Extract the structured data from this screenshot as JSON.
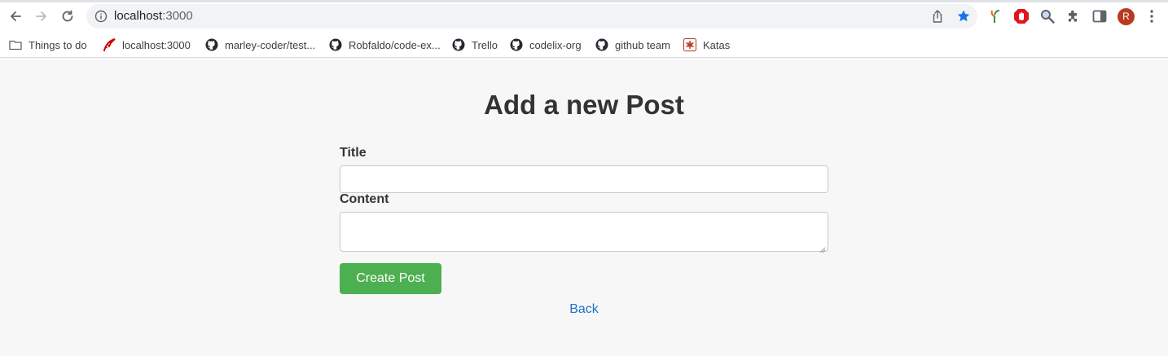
{
  "browser": {
    "url_host": "localhost",
    "url_port": ":3000",
    "avatar_letter": "R"
  },
  "bookmarks": [
    {
      "label": "Things to do",
      "icon": "folder-icon"
    },
    {
      "label": "localhost:3000",
      "icon": "rails-icon"
    },
    {
      "label": "marley-coder/test...",
      "icon": "github-icon"
    },
    {
      "label": "Robfaldo/code-ex...",
      "icon": "github-icon"
    },
    {
      "label": "Trello",
      "icon": "github-icon"
    },
    {
      "label": "codelix-org",
      "icon": "github-icon"
    },
    {
      "label": "github team",
      "icon": "github-icon"
    },
    {
      "label": "Katas",
      "icon": "codewars-icon"
    }
  ],
  "page": {
    "title": "Add a new Post",
    "title_label": "Title",
    "content_label": "Content",
    "title_value": "",
    "content_value": "",
    "submit_label": "Create Post",
    "back_label": "Back"
  },
  "colors": {
    "submit_button": "#4caf50",
    "back_link": "#1a73c9",
    "page_background": "#f7f7f7"
  }
}
